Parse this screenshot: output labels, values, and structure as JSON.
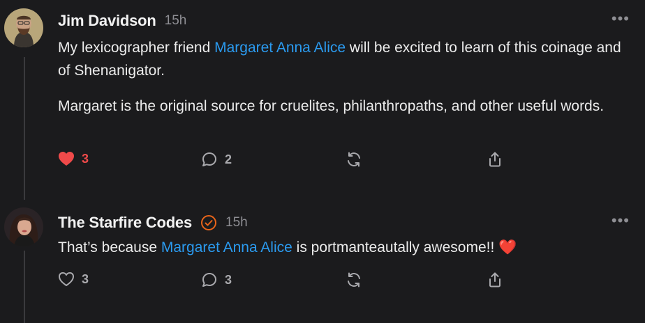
{
  "comments": [
    {
      "author": "Jim Davidson",
      "time": "15h",
      "text_1a": "My lexicographer friend ",
      "mention_1": "Margaret Anna Alice",
      "text_1b": " will be excited to learn of this coinage and of Shenanigator.",
      "text_2": "Margaret is the original source for cruelites, philanthropaths, and other useful words.",
      "likes": "3",
      "replies": "2",
      "liked": true
    },
    {
      "author": "The Starfire Codes",
      "time": "15h",
      "text_1a": "That’s because ",
      "mention_1": "Margaret Anna Alice",
      "text_1b": " is portmanteautally awesome!! ❤️",
      "likes": "3",
      "replies": "3",
      "liked": false
    }
  ],
  "more_label": "•••",
  "colors": {
    "accent_link": "#2b9bf0",
    "like_red": "#f04a4a",
    "verified_orange": "#e8641a"
  }
}
